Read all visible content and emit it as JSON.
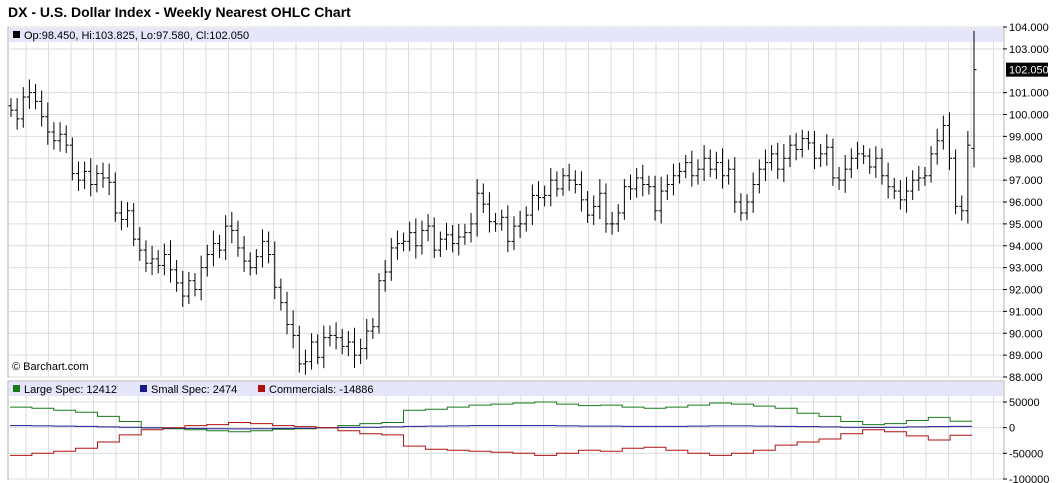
{
  "title": "DX - U.S. Dollar Index - Weekly Nearest OHLC Chart",
  "watermark": "© Barchart.com",
  "ohlc_legend": {
    "text": "Op:98.450, Hi:103.825, Lo:97.580, Cl:102.050",
    "last_price_label": "102.050"
  },
  "cot_legend": [
    {
      "label": "Large Spec: 12412",
      "color": "#1a7a1a"
    },
    {
      "label": "Small Spec: 2474",
      "color": "#1a1a8c"
    },
    {
      "label": "Commercials: -14886",
      "color": "#b01010"
    }
  ],
  "colors": {
    "bar": "#000000",
    "grid": "#dddddd",
    "legend_bg": "#e6e6fa",
    "last_price_bg": "#000000"
  },
  "chart_data": [
    {
      "type": "ohlc",
      "title": "DX - U.S. Dollar Index - Weekly Nearest OHLC Chart",
      "ylim": [
        88,
        104
      ],
      "y_ticks": [
        "104.000",
        "103.000",
        "102.050",
        "101.000",
        "100.000",
        "99.000",
        "98.000",
        "97.000",
        "96.000",
        "95.000",
        "94.000",
        "93.000",
        "92.000",
        "91.000",
        "90.000",
        "89.000",
        "88.000"
      ],
      "last": {
        "open": 98.45,
        "high": 103.825,
        "low": 97.58,
        "close": 102.05
      },
      "closes": [
        100.2,
        99.8,
        100.8,
        101.0,
        100.6,
        99.9,
        99.2,
        98.8,
        99.1,
        98.6,
        97.3,
        97.0,
        97.4,
        96.8,
        97.3,
        97.1,
        96.9,
        95.5,
        95.2,
        95.6,
        94.3,
        93.8,
        93.2,
        93.4,
        93.1,
        93.6,
        92.9,
        92.3,
        91.7,
        92.4,
        92.0,
        93.0,
        93.6,
        94.1,
        93.8,
        94.9,
        94.7,
        93.9,
        93.3,
        93.0,
        93.5,
        94.2,
        93.6,
        92.1,
        91.4,
        90.4,
        89.9,
        88.6,
        88.7,
        89.6,
        88.9,
        89.8,
        89.9,
        89.8,
        89.4,
        89.6,
        89.0,
        89.3,
        90.1,
        90.3,
        92.4,
        92.8,
        93.9,
        94.1,
        94.2,
        94.6,
        94.0,
        94.7,
        94.9,
        93.8,
        94.3,
        94.5,
        94.1,
        94.4,
        94.6,
        95.0,
        96.4,
        95.9,
        95.1,
        95.0,
        95.3,
        94.2,
        94.9,
        95.0,
        95.4,
        96.3,
        96.2,
        96.3,
        97.0,
        96.6,
        97.2,
        97.0,
        96.8,
        96.1,
        95.4,
        95.8,
        96.4,
        95.0,
        95.0,
        95.5,
        96.7,
        96.6,
        97.1,
        96.8,
        96.7,
        95.6,
        96.5,
        96.8,
        97.2,
        97.4,
        97.8,
        97.2,
        97.5,
        98.0,
        97.5,
        97.8,
        97.2,
        97.5,
        96.0,
        95.5,
        96.0,
        96.8,
        97.5,
        97.8,
        98.2,
        97.5,
        98.0,
        98.6,
        98.4,
        98.9,
        98.7,
        98.0,
        98.2,
        98.5,
        97.1,
        97.0,
        97.5,
        98.0,
        98.2,
        98.1,
        97.6,
        98.0,
        97.2,
        96.7,
        96.5,
        96.1,
        96.5,
        97.0,
        97.1,
        97.2,
        98.2,
        98.8,
        99.5,
        98.0,
        95.8,
        95.6,
        98.6,
        102.05
      ]
    },
    {
      "type": "line",
      "title": "COT",
      "ylim": [
        -100000,
        50000
      ],
      "y_ticks": [
        "50000",
        "0",
        "-50000",
        "-100000"
      ],
      "series": [
        {
          "name": "Large Spec: 12412",
          "values": [
            40000,
            38000,
            34000,
            30000,
            22000,
            12000,
            0,
            -2000,
            -4000,
            -6000,
            -8000,
            -6000,
            -3000,
            -2000,
            0,
            4000,
            8000,
            10000,
            34000,
            36000,
            40000,
            44000,
            46000,
            48000,
            50000,
            46000,
            43000,
            44000,
            40000,
            38000,
            40000,
            44000,
            48000,
            46000,
            42000,
            38000,
            28000,
            22000,
            12000,
            6000,
            8000,
            14000,
            20000,
            12412
          ]
        },
        {
          "name": "Small Spec: 2474",
          "values": [
            4000,
            3500,
            3000,
            2500,
            1500,
            1000,
            -500,
            -1000,
            -1500,
            -2000,
            -2500,
            -2000,
            -1500,
            -1000,
            0,
            500,
            1000,
            1500,
            2500,
            3000,
            3500,
            4000,
            4000,
            4000,
            4000,
            3500,
            3000,
            3000,
            2500,
            2500,
            2500,
            3000,
            3500,
            3500,
            3000,
            2500,
            2000,
            1500,
            1000,
            500,
            1000,
            1500,
            2000,
            2474
          ]
        },
        {
          "name": "Commercials: -14886",
          "values": [
            -54000,
            -50000,
            -46000,
            -40000,
            -28000,
            -14000,
            -4000,
            0,
            4000,
            6000,
            10000,
            8000,
            4000,
            2000,
            0,
            -6000,
            -12000,
            -14000,
            -36000,
            -42000,
            -44000,
            -46000,
            -48000,
            -50000,
            -54000,
            -50000,
            -44000,
            -46000,
            -40000,
            -38000,
            -44000,
            -50000,
            -54000,
            -50000,
            -44000,
            -34000,
            -28000,
            -22000,
            -12000,
            -4000,
            -8000,
            -16000,
            -24000,
            -14886
          ]
        }
      ]
    }
  ]
}
